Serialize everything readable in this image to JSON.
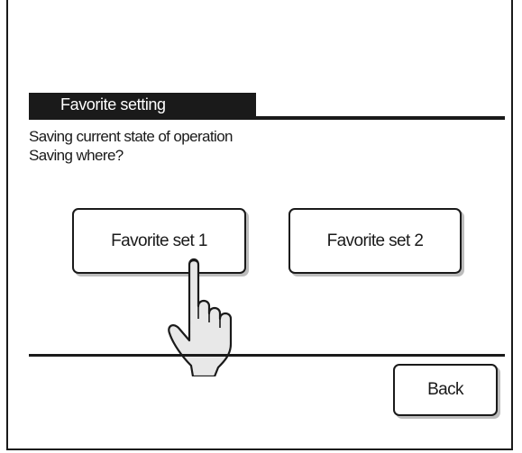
{
  "header": {
    "title": "Favorite setting"
  },
  "message": {
    "line1": "Saving current state of operation",
    "line2": "Saving where?"
  },
  "options": [
    {
      "label": "Favorite set 1",
      "pressed": true
    },
    {
      "label": "Favorite set 2",
      "pressed": false
    }
  ],
  "footer": {
    "back_label": "Back"
  },
  "icons": {
    "pointer": "hand-pointer-icon"
  },
  "colors": {
    "foreground": "#1a1a1a",
    "background": "#ffffff",
    "button_shadow": "#bdbdbd",
    "hand_fill": "#e8e8e8"
  }
}
